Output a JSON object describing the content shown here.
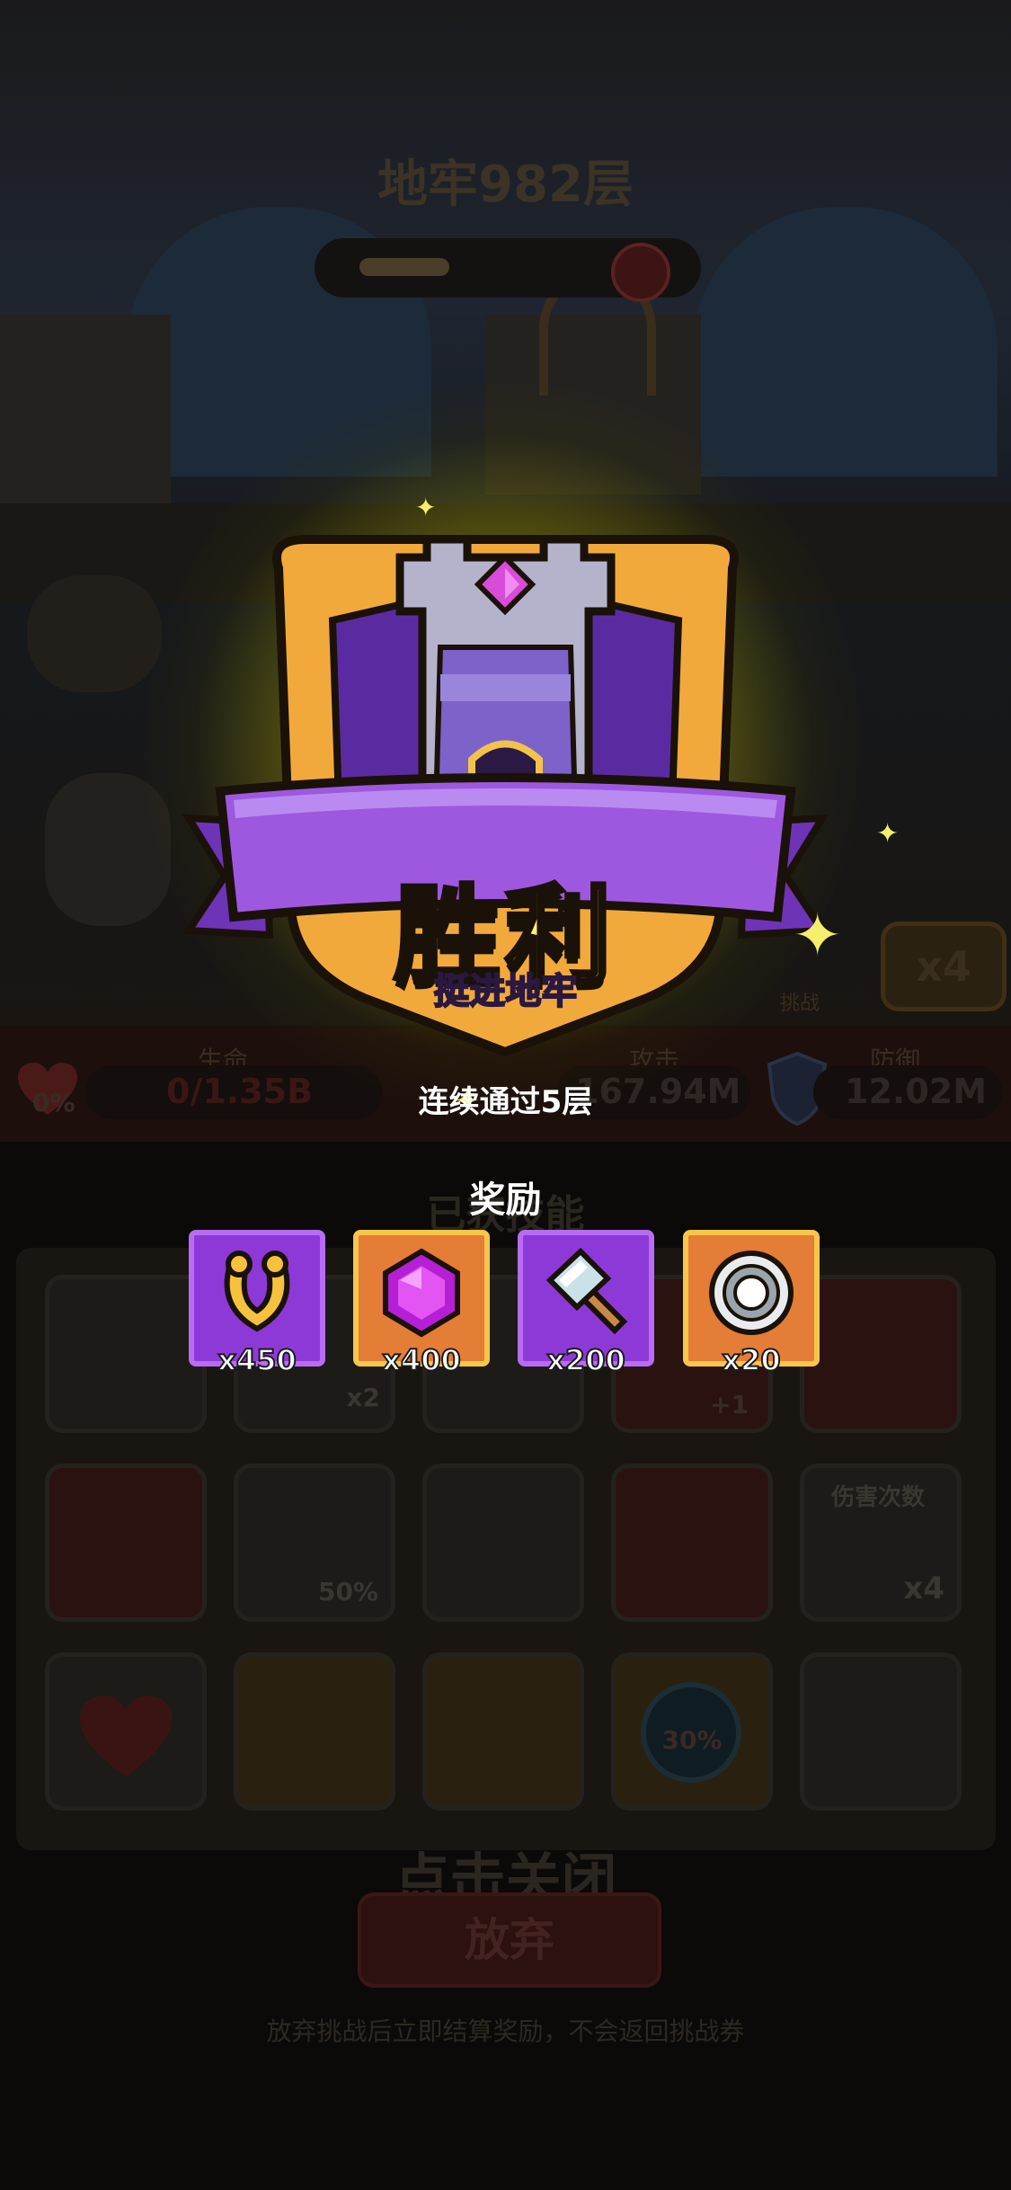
{
  "background": {
    "dungeon_title": "地牢982层",
    "stats": {
      "hp_label": "生命",
      "hp_value": "0/1.35B",
      "hp_percent": "0%",
      "atk_label": "攻击",
      "atk_value": "167.94M",
      "def_label": "防御",
      "def_value": "12.02M"
    },
    "speed": "x4",
    "challenge_label": "挑战",
    "skills_title": "已获技能",
    "skill_badges": [
      "x2",
      "+1",
      "50%",
      "伤害次数",
      "x4",
      "30%"
    ],
    "tap_to_close": "点击关闭",
    "abandon_button": "放弃",
    "abandon_note": "放弃挑战后立即结算奖励，不会返回挑战券"
  },
  "victory": {
    "title": "胜利",
    "subtitle": "挺进地牢",
    "consecutive_text": "连续通过5层"
  },
  "rewards": {
    "title": "奖励",
    "items": [
      {
        "icon": "horseshoe-icon",
        "count": "x450",
        "bg": "#8d39d8"
      },
      {
        "icon": "purple-gem-icon",
        "count": "x400",
        "bg": "#e47d35"
      },
      {
        "icon": "hammer-icon",
        "count": "x200",
        "bg": "#8d39d8"
      },
      {
        "icon": "silver-coin-icon",
        "count": "x20",
        "bg": "#e47d35"
      }
    ]
  },
  "colors": {
    "victory_text": "#fff36b",
    "banner_purple": "#9e58e0",
    "shield_orange": "#f2a93c",
    "glow": "#cdc814"
  }
}
